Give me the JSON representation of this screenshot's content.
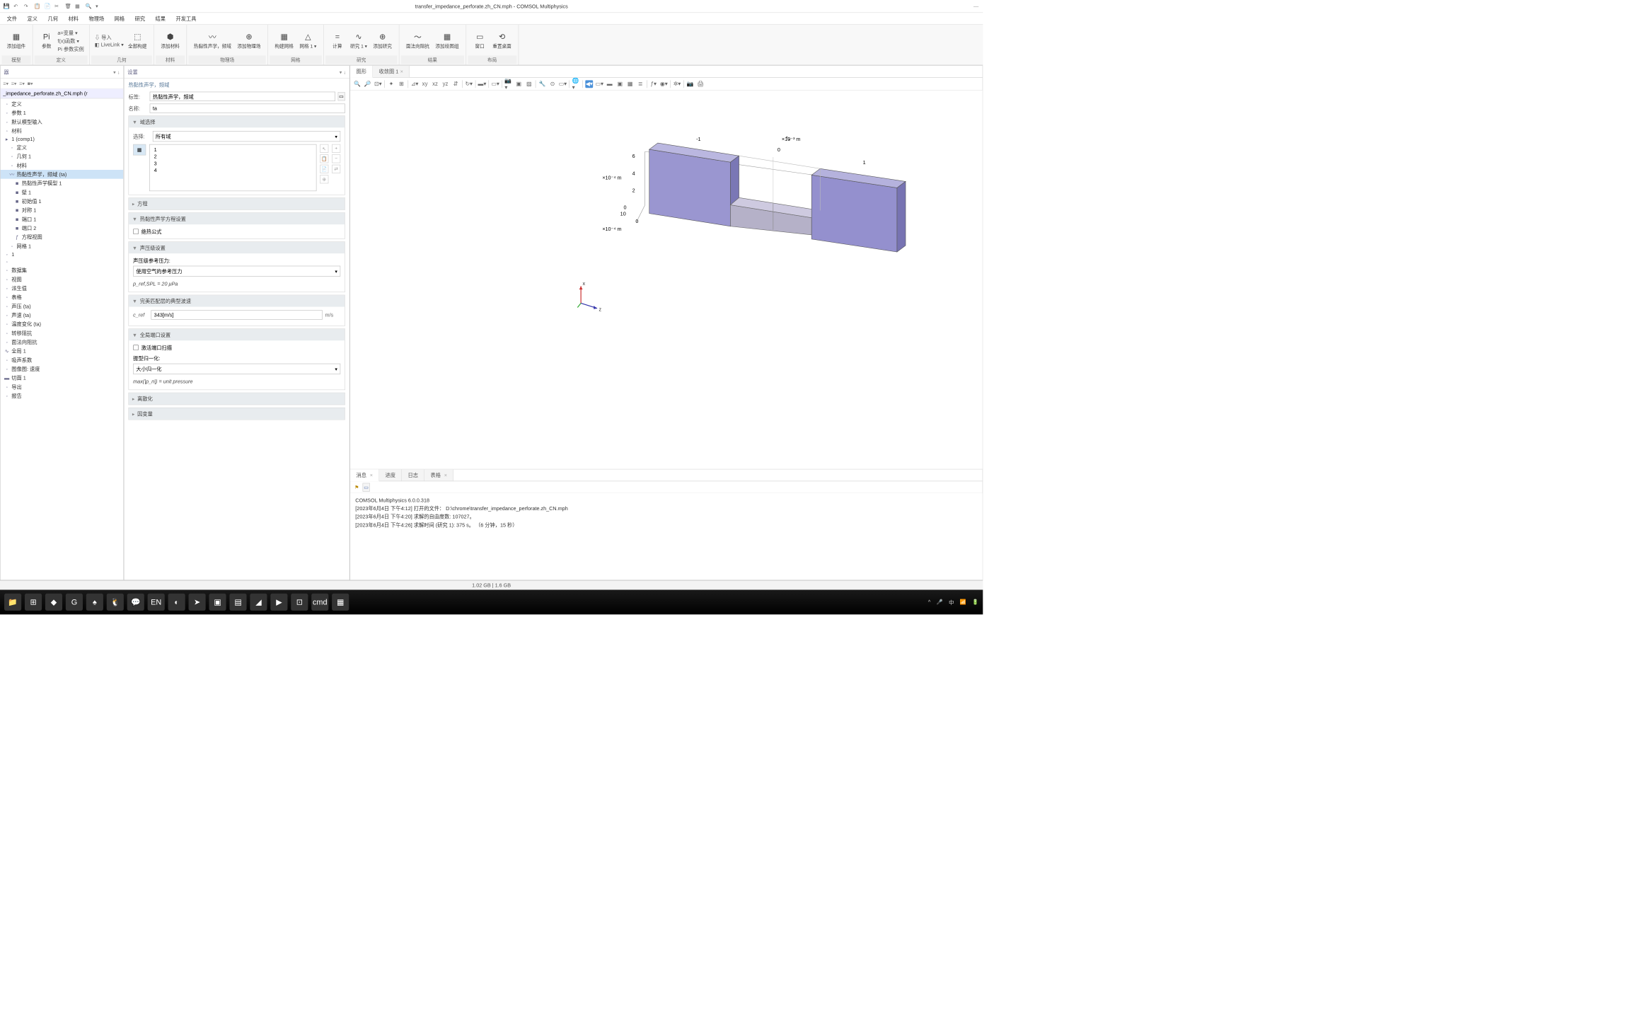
{
  "window": {
    "title": "transfer_impedance_perforate.zh_CN.mph - COMSOL Multiphysics",
    "minimize": "—"
  },
  "menu": {
    "items": [
      "文件",
      "定义",
      "几何",
      "材料",
      "物理场",
      "网格",
      "研究",
      "结果",
      "开发工具"
    ],
    "active_index": -1
  },
  "ribbon": {
    "groups": [
      {
        "label": "模型",
        "items": [
          {
            "icon": "▦",
            "text": "添加组件"
          }
        ]
      },
      {
        "label": "定义",
        "items": [],
        "stack": [
          "a=变量 ▾",
          "f(x)函数 ▾",
          "Pi 参数实例"
        ],
        "leading": {
          "icon": "Pi",
          "text": "参数"
        }
      },
      {
        "label": "几何",
        "items": [
          {
            "icon": "⬚",
            "text": "全部构建"
          }
        ],
        "stack": [
          "⇩ 导入",
          "◧ LiveLink ▾"
        ]
      },
      {
        "label": "材料",
        "items": [
          {
            "icon": "⬢",
            "text": "添加材料"
          }
        ]
      },
      {
        "label": "物理场",
        "items": [
          {
            "icon": "〰",
            "text": "热黏性声学，频域"
          },
          {
            "icon": "⊕",
            "text": "添加物理场"
          }
        ]
      },
      {
        "label": "网格",
        "items": [
          {
            "icon": "▦",
            "text": "构建网格"
          },
          {
            "icon": "△",
            "text": "网格 1 ▾"
          }
        ]
      },
      {
        "label": "研究",
        "items": [
          {
            "icon": "=",
            "text": "计算"
          },
          {
            "icon": "∿",
            "text": "研究 1 ▾"
          },
          {
            "icon": "⊕",
            "text": "添加研究"
          }
        ]
      },
      {
        "label": "结果",
        "items": [
          {
            "icon": "〜",
            "text": "面法向阻抗"
          },
          {
            "icon": "▦",
            "text": "添加绘图组"
          }
        ]
      },
      {
        "label": "布局",
        "items": [
          {
            "icon": "▭",
            "text": "窗口"
          },
          {
            "icon": "⟲",
            "text": "重置桌面"
          }
        ]
      }
    ]
  },
  "tree": {
    "title": "模型开发器",
    "filename_tab": "_impedance_perforate.zh_CN.mph (r",
    "items": [
      {
        "l": 1,
        "t": "定义"
      },
      {
        "l": 1,
        "t": "参数 1"
      },
      {
        "l": 1,
        "t": "默认模型输入"
      },
      {
        "l": 1,
        "t": "材料"
      },
      {
        "l": 1,
        "t": "1 (comp1)",
        "i": "▸"
      },
      {
        "l": 2,
        "t": "定义"
      },
      {
        "l": 2,
        "t": "几何 1"
      },
      {
        "l": 2,
        "t": "材料"
      },
      {
        "l": 2,
        "t": "热黏性声学，频域 (ta)",
        "sel": true,
        "i": "〰"
      },
      {
        "l": 3,
        "t": "热黏性声学模型 1",
        "i": "■"
      },
      {
        "l": 3,
        "t": "壁 1",
        "i": "■"
      },
      {
        "l": 3,
        "t": "初始值 1",
        "i": "■"
      },
      {
        "l": 3,
        "t": "对称 1",
        "i": "■"
      },
      {
        "l": 3,
        "t": "端口 1",
        "i": "■"
      },
      {
        "l": 3,
        "t": "端口 2",
        "i": "■"
      },
      {
        "l": 3,
        "t": "方程视图",
        "i": "ƒ"
      },
      {
        "l": 2,
        "t": "网格 1"
      },
      {
        "l": 1,
        "t": "1"
      },
      {
        "l": 1,
        "t": ""
      },
      {
        "l": 1,
        "t": "数据集"
      },
      {
        "l": 1,
        "t": "视图"
      },
      {
        "l": 1,
        "t": "派生值"
      },
      {
        "l": 1,
        "t": "表格"
      },
      {
        "l": 1,
        "t": "声压 (ta)"
      },
      {
        "l": 1,
        "t": "声速 (ta)"
      },
      {
        "l": 1,
        "t": "温度变化 (ta)"
      },
      {
        "l": 1,
        "t": "转移阻抗"
      },
      {
        "l": 1,
        "t": "面法向阻抗"
      },
      {
        "l": 1,
        "t": "全局 1",
        "i": "∿"
      },
      {
        "l": 1,
        "t": "吸声系数"
      },
      {
        "l": 1,
        "t": "图像图: 速度"
      },
      {
        "l": 1,
        "t": "切面 1",
        "i": "▬"
      },
      {
        "l": 1,
        "t": "导出"
      },
      {
        "l": 1,
        "t": "报告"
      }
    ]
  },
  "settings": {
    "title": "设置",
    "crumb": "热黏性声学，频域",
    "label_lbl": "标签:",
    "label_val": "热黏性声学，频域",
    "name_lbl": "名称:",
    "name_val": "ta",
    "domain_sel": {
      "hdr": "域选择",
      "choose": "选择:",
      "dd": "所有域",
      "items": [
        "1",
        "2",
        "3",
        "4"
      ]
    },
    "sections": [
      {
        "hdr": "方程",
        "open": false
      },
      {
        "hdr": "热黏性声学方程设置",
        "open": true,
        "content": {
          "type": "chk",
          "label": "绝热公式",
          "checked": false
        }
      },
      {
        "hdr": "声压级设置",
        "open": true,
        "content": {
          "type": "pref",
          "label": "声压级参考压力:",
          "dd": "使用空气的参考压力",
          "eq": "p_ref,SPL = 20 μPa"
        }
      },
      {
        "hdr": "完美匹配层的典型波速",
        "open": true,
        "content": {
          "type": "cref",
          "label": "c_ref",
          "val": "343[m/s]",
          "unit": "m/s"
        }
      },
      {
        "hdr": "全局端口设置",
        "open": true,
        "content": {
          "type": "port",
          "chk": "激活端口扫描",
          "norm_lbl": "振型归一化:",
          "norm_dd": "大小归一化",
          "eq": "max(|p_n|) = unit pressure"
        }
      },
      {
        "hdr": "离散化",
        "open": false
      },
      {
        "hdr": "因变量",
        "open": false
      }
    ]
  },
  "graphics": {
    "tabs": [
      {
        "label": "图形",
        "active": true
      },
      {
        "label": "收敛图 1",
        "active": false,
        "close": true
      }
    ],
    "axis": {
      "ylabel": "×10⁻⁴ m",
      "y2label": "×10⁻⁴ m",
      "xlabel": "×10⁻³ m",
      "yticks": [
        "6",
        "4",
        "2"
      ],
      "y2ticks": [
        "0",
        "10"
      ],
      "y2bottom": "0",
      "xtick_neg": "-1",
      "xtick_0": "0",
      "xtick_1": "1"
    },
    "triad": {
      "x": "x",
      "z": "z"
    },
    "cursor_pos": "⤢"
  },
  "messages": {
    "tabs": [
      {
        "label": "消息",
        "active": true,
        "close": true
      },
      {
        "label": "进度"
      },
      {
        "label": "日志"
      },
      {
        "label": "表格",
        "close": true
      }
    ],
    "lines": [
      "COMSOL Multiphysics 6.0.0.318",
      "[2023年6月4日 下午4:12] 打开的文件： D:\\chrome\\transfer_impedance_perforate.zh_CN.mph",
      "[2023年6月4日 下午4:20] 求解的自由度数: 107027。",
      "[2023年6月4日 下午4:26] 求解时间 (研究 1): 375 s。  （6 分钟，15 秒）"
    ]
  },
  "status": {
    "mem": "1.02 GB | 1.6 GB"
  },
  "taskbar": {
    "apps": [
      "📁",
      "⊞",
      "◆",
      "G",
      "♠",
      "🐧",
      "💬",
      "EN",
      "◐",
      "➤",
      "▣",
      "▤",
      "◢",
      "▶",
      "⊡",
      "cmd",
      "▦"
    ],
    "sys": [
      "^",
      "🎤",
      "中",
      "📶",
      "🔋"
    ]
  }
}
